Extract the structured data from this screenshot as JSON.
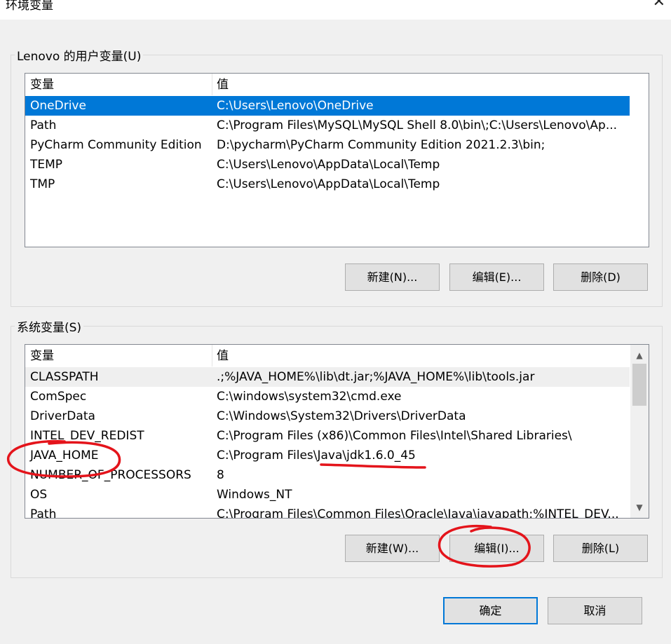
{
  "window": {
    "title": "环境变量",
    "close_glyph": "✕"
  },
  "user_vars": {
    "legend": "Lenovo 的用户变量(U)",
    "columns": [
      "变量",
      "值"
    ],
    "rows": [
      {
        "name": "OneDrive",
        "value": "C:\\Users\\Lenovo\\OneDrive",
        "selected": true
      },
      {
        "name": "Path",
        "value": "C:\\Program Files\\MySQL\\MySQL Shell 8.0\\bin\\;C:\\Users\\Lenovo\\Ap..."
      },
      {
        "name": "PyCharm Community Edition",
        "value": "D:\\pycharm\\PyCharm Community Edition 2021.2.3\\bin;"
      },
      {
        "name": "TEMP",
        "value": "C:\\Users\\Lenovo\\AppData\\Local\\Temp"
      },
      {
        "name": "TMP",
        "value": "C:\\Users\\Lenovo\\AppData\\Local\\Temp"
      }
    ],
    "buttons": {
      "new": "新建(N)...",
      "edit": "编辑(E)...",
      "delete": "删除(D)"
    }
  },
  "system_vars": {
    "legend": "系统变量(S)",
    "columns": [
      "变量",
      "值"
    ],
    "rows": [
      {
        "name": "CLASSPATH",
        "value": ".;%JAVA_HOME%\\lib\\dt.jar;%JAVA_HOME%\\lib\\tools.jar",
        "highlight": true
      },
      {
        "name": "ComSpec",
        "value": "C:\\windows\\system32\\cmd.exe"
      },
      {
        "name": "DriverData",
        "value": "C:\\Windows\\System32\\Drivers\\DriverData"
      },
      {
        "name": "INTEL_DEV_REDIST",
        "value": "C:\\Program Files (x86)\\Common Files\\Intel\\Shared Libraries\\"
      },
      {
        "name": "JAVA_HOME",
        "value": "C:\\Program Files\\Java\\jdk1.6.0_45"
      },
      {
        "name": "NUMBER_OF_PROCESSORS",
        "value": "8"
      },
      {
        "name": "OS",
        "value": "Windows_NT"
      },
      {
        "name": "Path",
        "value": "C:\\Program Files\\Common Files\\Oracle\\Java\\javapath;%INTEL_DEV..."
      }
    ],
    "buttons": {
      "new": "新建(W)...",
      "edit": "编辑(I)...",
      "delete": "删除(L)"
    },
    "scroll": {
      "up_glyph": "▲",
      "down_glyph": "▼"
    }
  },
  "footer": {
    "ok": "确定",
    "cancel": "取消"
  },
  "colors": {
    "selection": "#0078d7",
    "annotation": "#e4141b"
  }
}
